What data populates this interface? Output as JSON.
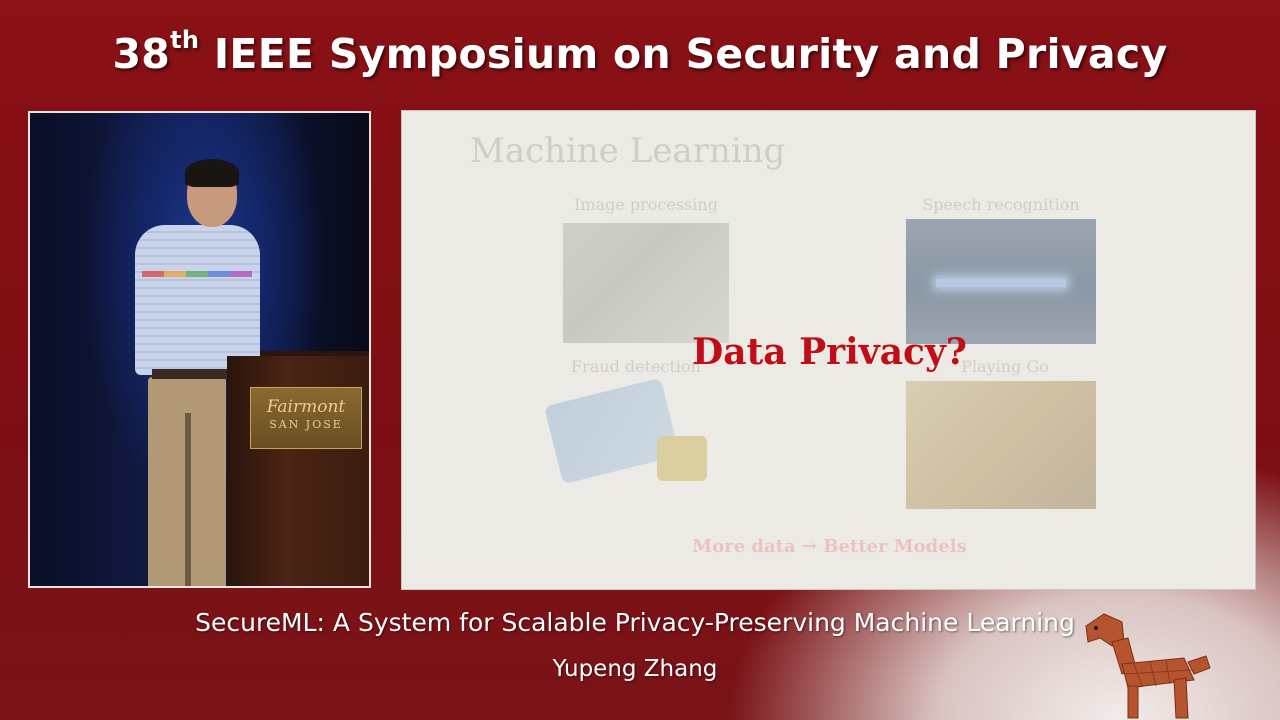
{
  "header": {
    "title_number": "38",
    "title_superscript": "th",
    "title_rest": " IEEE Symposium on Security and Privacy"
  },
  "video": {
    "plaque_line1": "Fairmont",
    "plaque_line2": "SAN JOSE"
  },
  "slide": {
    "heading": "Machine Learning",
    "panels": [
      {
        "caption": "Image processing"
      },
      {
        "caption": "Speech recognition"
      },
      {
        "caption": "Fraud detection"
      },
      {
        "caption": "Playing Go"
      }
    ],
    "tagline": "More data → Better Models",
    "overlay": "Data Privacy?"
  },
  "footer": {
    "talk_title": "SecureML: A System for Scalable Privacy-Preserving Machine Learning",
    "speaker": "Yupeng Zhang"
  },
  "colors": {
    "background": "#7d0f14",
    "overlay_red": "#c20d16"
  },
  "icons": {
    "logo": "trojan-horse-icon"
  }
}
